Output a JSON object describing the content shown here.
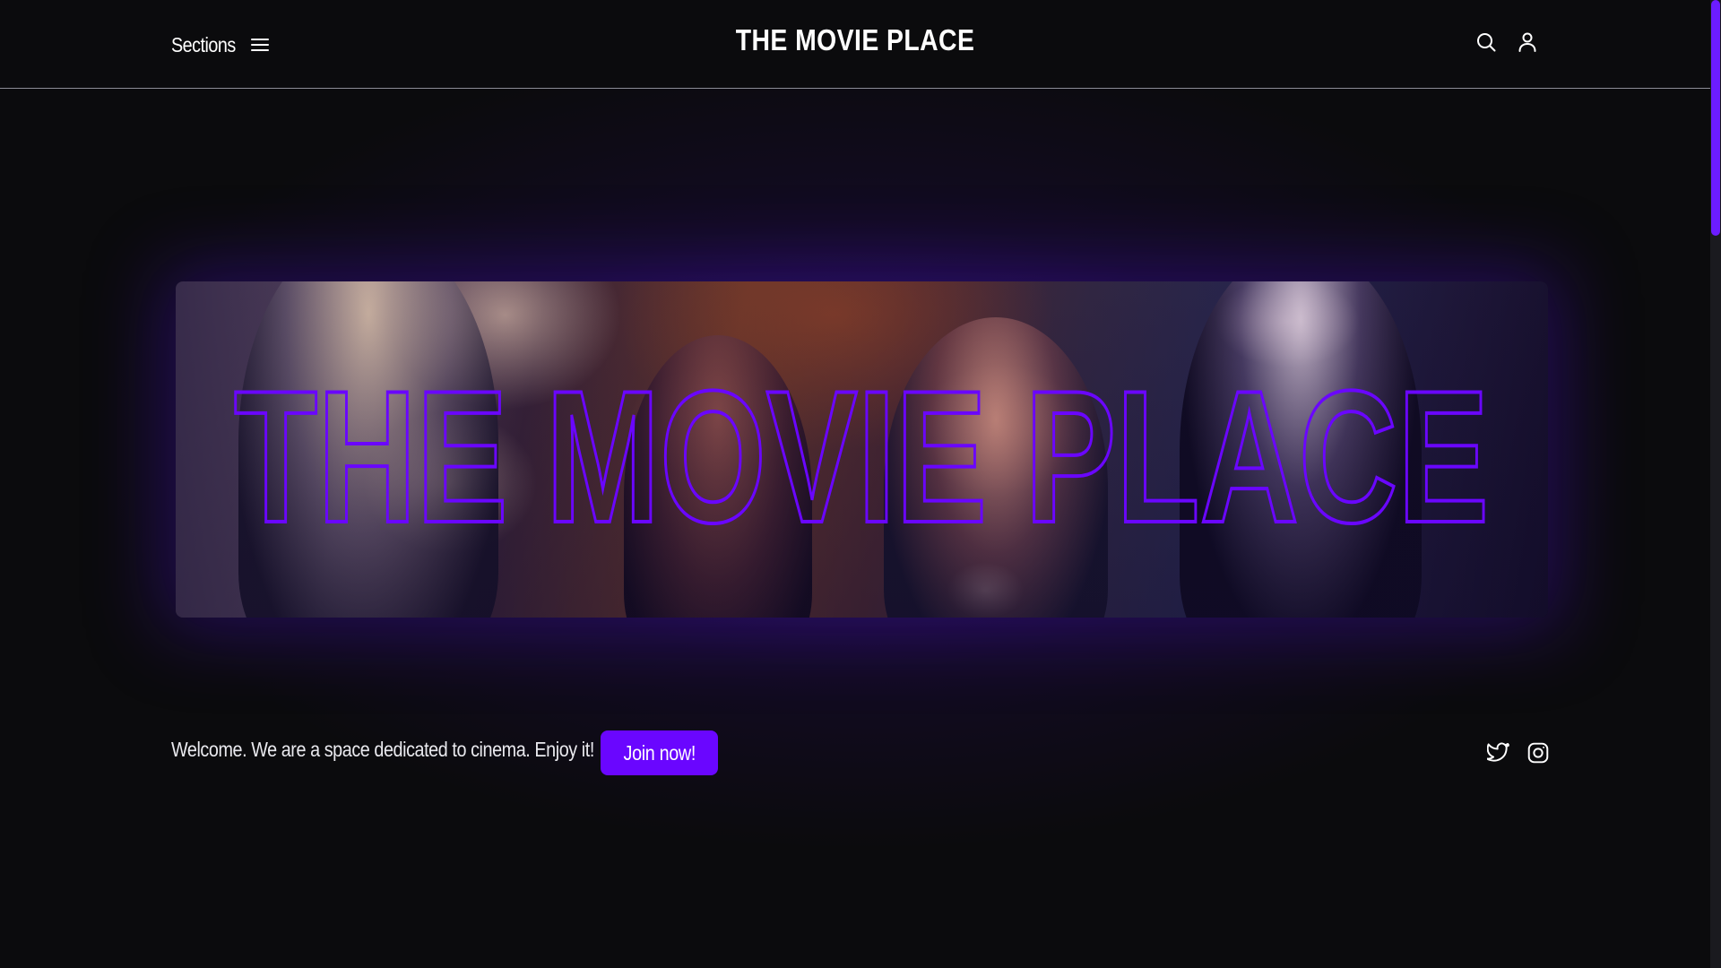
{
  "header": {
    "sections_label": "Sections",
    "brand_title": "THE MOVIE PLACE",
    "icons": [
      "menu-icon",
      "search-icon",
      "user-icon"
    ]
  },
  "banner": {
    "overlay_title": "THE MOVIE PLACE",
    "outline_color": "#6a06ff"
  },
  "footer_bar": {
    "welcome_text": "Welcome. We are a space dedicated to cinema. Enjoy it!",
    "join_label": "Join now!",
    "social_icons": [
      "twitter-icon",
      "instagram-icon"
    ]
  },
  "colors": {
    "accent": "#6a06ff",
    "background": "#0b0b0d",
    "text": "#ffffff"
  }
}
